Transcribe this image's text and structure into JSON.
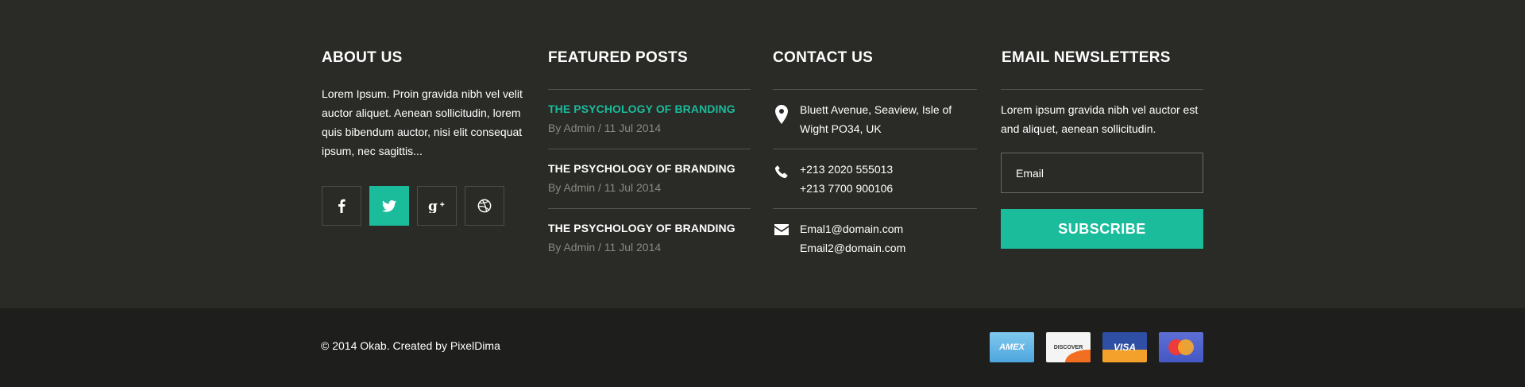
{
  "about": {
    "title": "ABOUT US",
    "text": "Lorem Ipsum. Proin gravida nibh vel velit auctor aliquet. Aenean sollicitudin, lorem quis bibendum auctor, nisi elit consequat ipsum, nec sagittis...",
    "social": [
      {
        "icon": "facebook-icon",
        "active": false
      },
      {
        "icon": "twitter-icon",
        "active": true
      },
      {
        "icon": "google-plus-icon",
        "active": false
      },
      {
        "icon": "dribbble-icon",
        "active": false
      }
    ]
  },
  "posts": {
    "title": "FEATURED POSTS",
    "items": [
      {
        "title": "THE PSYCHOLOGY OF BRANDING",
        "meta": "By Admin / 11 Jul 2014",
        "highlighted": true
      },
      {
        "title": "THE PSYCHOLOGY OF BRANDING",
        "meta": "By Admin / 11 Jul 2014",
        "highlighted": false
      },
      {
        "title": "THE PSYCHOLOGY OF BRANDING",
        "meta": "By Admin / 11 Jul 2014",
        "highlighted": false
      }
    ]
  },
  "contact": {
    "title": "CONTACT US",
    "address": {
      "line1": "Bluett Avenue, Seaview, Isle of",
      "line2": "Wight PO34, UK",
      "icon": "map-pin-icon"
    },
    "phone": {
      "line1": "+213 2020 555013",
      "line2": "+213 7700 900106",
      "icon": "phone-icon"
    },
    "email": {
      "line1": "Emal1@domain.com",
      "line2": "Email2@domain.com",
      "icon": "envelope-icon"
    }
  },
  "newsletter": {
    "title": "EMAIL NEWSLETTERS",
    "text": "Lorem ipsum gravida nibh vel auctor est and aliquet, aenean sollicitudin.",
    "placeholder": "Email",
    "button": "SUBSCRIBE"
  },
  "bottom": {
    "copyright": "© 2014 Okab. Created by PixelDima",
    "cards": [
      {
        "name": "amex-card-icon",
        "label": "AMEX"
      },
      {
        "name": "discover-card-icon",
        "label": "DISCOVER"
      },
      {
        "name": "visa-card-icon",
        "label": "VISA"
      },
      {
        "name": "mastercard-card-icon",
        "label": ""
      }
    ]
  },
  "colors": {
    "accent": "#1abc9c",
    "footer_bg": "#2a2a26",
    "bottom_bg": "#1e1e1c",
    "meta_text": "#8a8a84"
  }
}
